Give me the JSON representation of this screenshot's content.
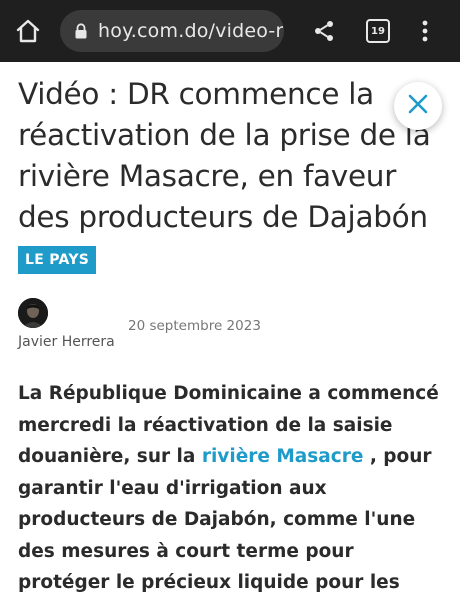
{
  "browser": {
    "url": "hoy.com.do/video-r",
    "tab_count": "19",
    "icons": {
      "home": "home-icon",
      "lock": "lock-icon",
      "share": "share-icon",
      "tabs": "tabs-icon",
      "menu": "more-vert-icon"
    }
  },
  "article": {
    "title": "Vidéo : DR commence la réactivation de la prise de la rivière Masacre, en faveur des producteurs de Dajabón",
    "category": "LE PAYS",
    "author": "Javier Herrera",
    "date": "20 septembre 2023",
    "body_before": "La République Dominicaine a commencé mercredi la réactivation de la saisie douanière, sur la ",
    "body_link": "rivière Masacre",
    "body_after": " , pour garantir l'eau d'irrigation aux producteurs de Dajabón, comme l'une des mesures à court terme pour protéger le précieux liquide pour les Dominicains."
  },
  "colors": {
    "accent": "#1e9bc8",
    "toolbar_bg": "#1f1f1f",
    "text": "#2b2b2b"
  }
}
